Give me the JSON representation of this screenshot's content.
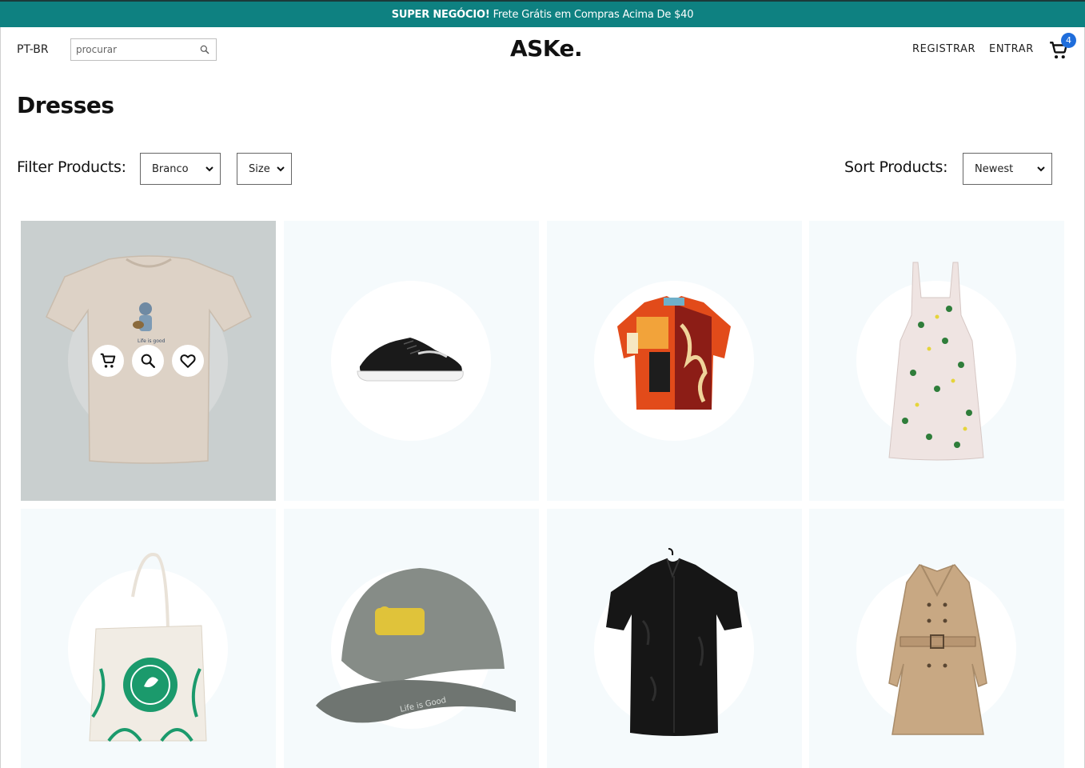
{
  "announcement": {
    "bold": "SUPER NEGÓCIO!",
    "text": "Frete Grátis em Compras Acima De $40"
  },
  "nav": {
    "language": "PT-BR",
    "search_placeholder": "procurar",
    "logo": "ASKe.",
    "register": "REGISTRAR",
    "login": "ENTRAR",
    "cart_count": "4"
  },
  "page": {
    "title": "Dresses"
  },
  "filters": {
    "label": "Filter Products:",
    "color_value": "Branco",
    "size_value": "Size",
    "sort_label": "Sort Products:",
    "sort_value": "Newest"
  },
  "colors": {
    "announcement_bg": "#0e8181",
    "card_bg": "#f5fafc",
    "badge": "#1f6ddb"
  },
  "products": [
    {
      "item": "beige t-shirt",
      "state": "hovered",
      "actions": [
        "cart-icon",
        "search-icon",
        "heart-icon"
      ]
    },
    {
      "item": "black sneaker"
    },
    {
      "item": "printed short-sleeve shirt"
    },
    {
      "item": "floral sundress"
    },
    {
      "item": "canvas tote bag"
    },
    {
      "item": "grey baseball cap"
    },
    {
      "item": "black silk shirt"
    },
    {
      "item": "beige trench coat"
    }
  ]
}
